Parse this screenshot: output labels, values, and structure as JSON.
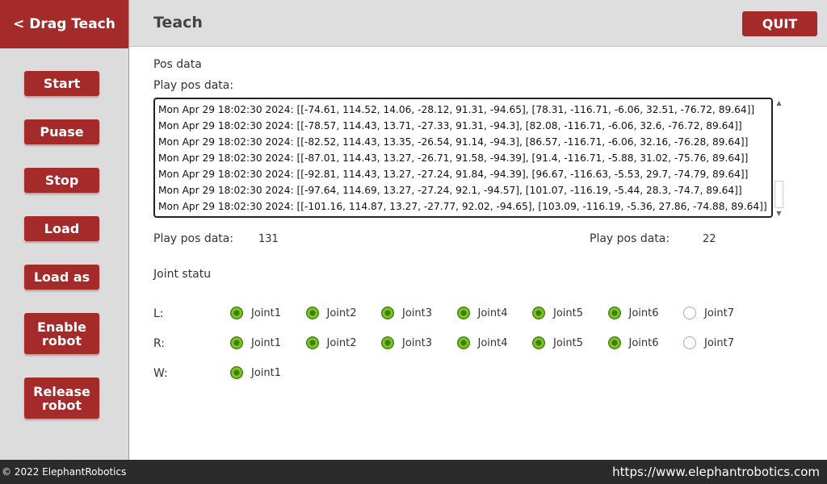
{
  "sidebar": {
    "back_label": "< Drag Teach",
    "buttons": [
      {
        "label": "Start"
      },
      {
        "label": "Puase"
      },
      {
        "label": "Stop"
      },
      {
        "label": "Load"
      },
      {
        "label": "Load as"
      },
      {
        "label": "Enable\nrobot"
      },
      {
        "label": "Release\nrobot"
      }
    ]
  },
  "header": {
    "title": "Teach",
    "quit_label": "QUIT"
  },
  "main": {
    "pos_data_label": "Pos data",
    "play_pos_label": "Play pos data:",
    "log_lines": [
      "Mon Apr 29 18:02:30 2024:  [[-74.61, 114.52, 14.06, -28.12, 91.31, -94.65], [78.31, -116.71, -6.06, 32.51, -76.72, 89.64]]",
      "Mon Apr 29 18:02:30 2024:  [[-78.57, 114.43, 13.71, -27.33, 91.31, -94.3], [82.08, -116.71, -6.06, 32.6, -76.72, 89.64]]",
      "Mon Apr 29 18:02:30 2024:  [[-82.52, 114.43, 13.35, -26.54, 91.14, -94.3], [86.57, -116.71, -6.06, 32.16, -76.28, 89.64]]",
      "Mon Apr 29 18:02:30 2024:  [[-87.01, 114.43, 13.27, -26.71, 91.58, -94.39], [91.4, -116.71, -5.88, 31.02, -75.76, 89.64]]",
      "Mon Apr 29 18:02:30 2024:  [[-92.81, 114.43, 13.27, -27.24, 91.84, -94.39], [96.67, -116.63, -5.53, 29.7, -74.79, 89.64]]",
      "Mon Apr 29 18:02:30 2024:  [[-97.64, 114.69, 13.27, -27.24, 92.1, -94.57], [101.07, -116.19, -5.44, 28.3, -74.7, 89.64]]",
      "Mon Apr 29 18:02:30 2024:  [[-101.16, 114.87, 13.27, -27.77, 92.02, -94.65], [103.09, -116.19, -5.36, 27.86, -74.88, 89.64]]"
    ],
    "count_left_label": "Play pos data:",
    "count_left_value": "131",
    "count_right_label": "Play pos data:",
    "count_right_value": "22",
    "joint_status_label": "Joint statu",
    "rows": [
      {
        "label": "L:",
        "joints": [
          {
            "name": "Joint1",
            "checked": true
          },
          {
            "name": "Joint2",
            "checked": true
          },
          {
            "name": "Joint3",
            "checked": true
          },
          {
            "name": "Joint4",
            "checked": true
          },
          {
            "name": "Joint5",
            "checked": true
          },
          {
            "name": "Joint6",
            "checked": true
          },
          {
            "name": "Joint7",
            "checked": false
          }
        ]
      },
      {
        "label": "R:",
        "joints": [
          {
            "name": "Joint1",
            "checked": true
          },
          {
            "name": "Joint2",
            "checked": true
          },
          {
            "name": "Joint3",
            "checked": true
          },
          {
            "name": "Joint4",
            "checked": true
          },
          {
            "name": "Joint5",
            "checked": true
          },
          {
            "name": "Joint6",
            "checked": true
          },
          {
            "name": "Joint7",
            "checked": false
          }
        ]
      },
      {
        "label": "W:",
        "joints": [
          {
            "name": "Joint1",
            "checked": true
          }
        ]
      }
    ]
  },
  "footer": {
    "copyright": "© 2022 ElephantRobotics",
    "url": "https://www.elephantrobotics.com"
  },
  "colors": {
    "accent": "#a52a2a",
    "radio_on": "#6db31a"
  }
}
